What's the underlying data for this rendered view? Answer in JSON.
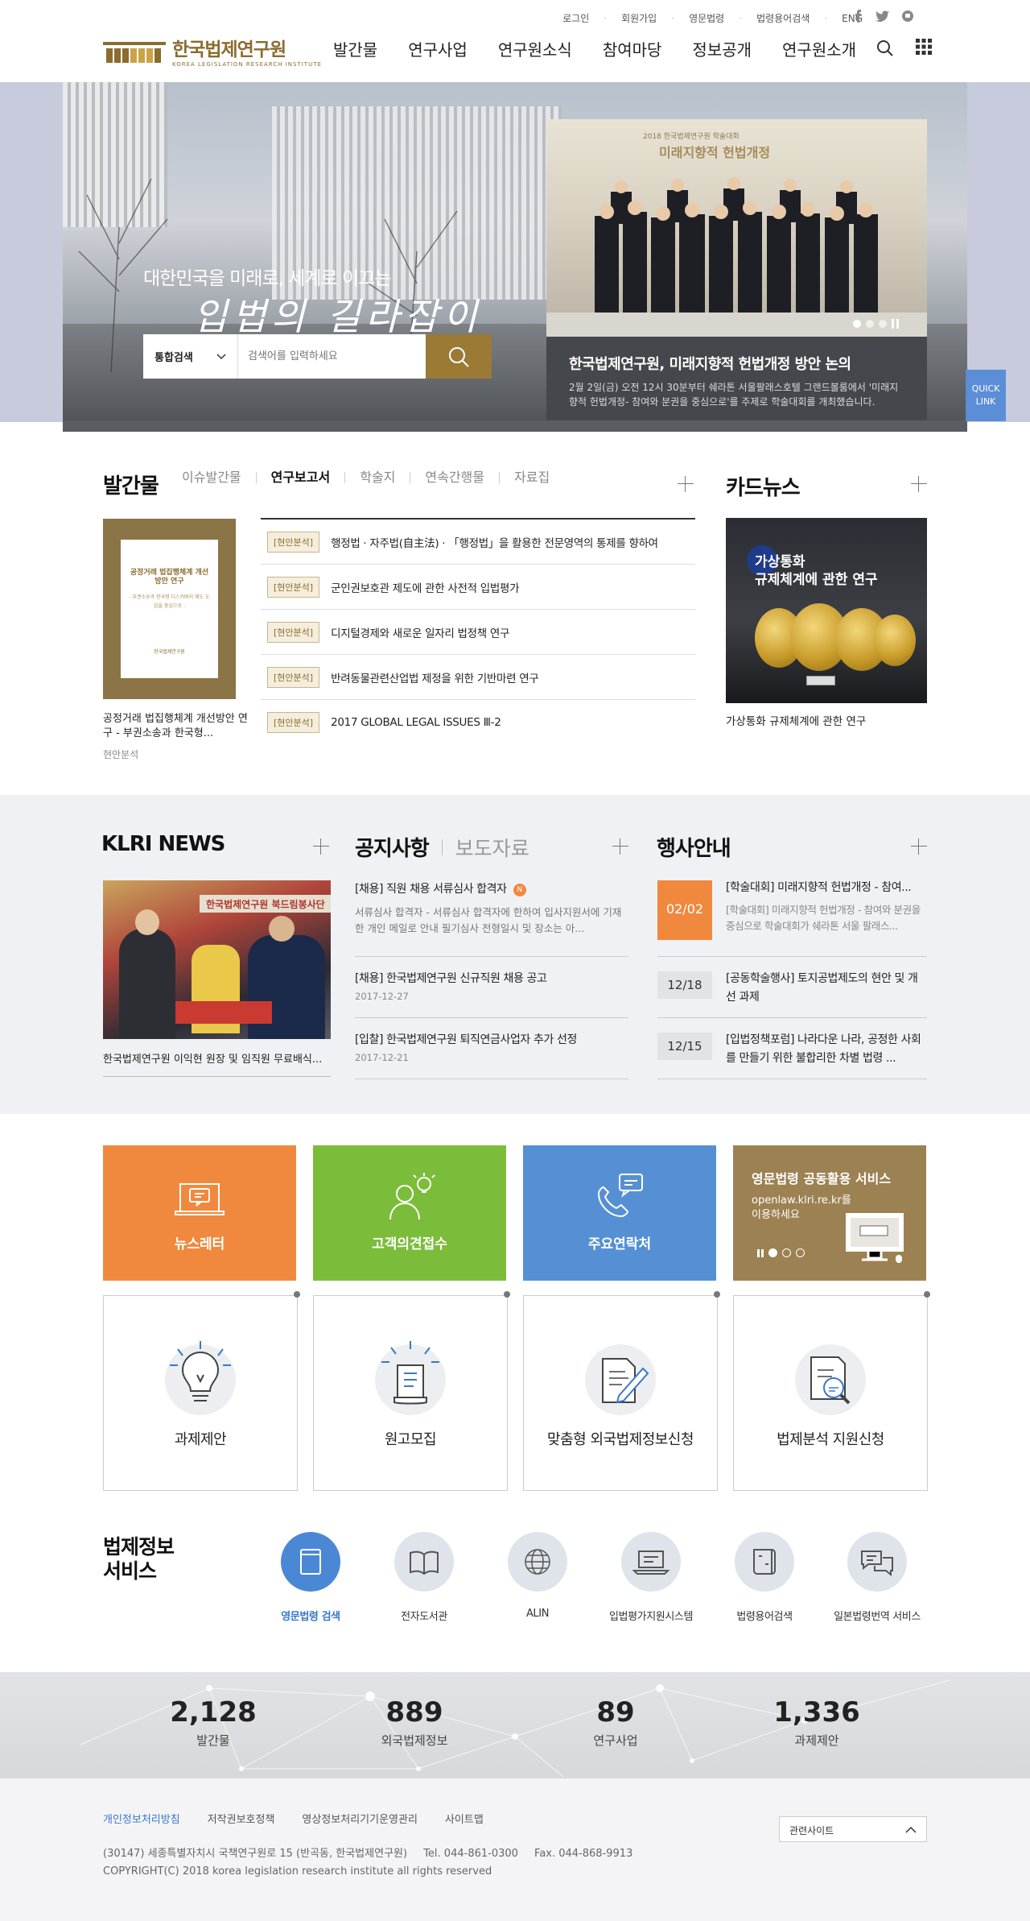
{
  "header": {
    "util_links": [
      "로그인",
      "회원가입",
      "영문법령",
      "법령용어검색",
      "ENG"
    ],
    "logo_ko": "한국법제연구원",
    "logo_en": "KOREA LEGISLATION RESEARCH INSTITUTE",
    "nav": [
      "발간물",
      "연구사업",
      "연구원소식",
      "참여마당",
      "정보공개",
      "연구원소개"
    ],
    "social_icons": [
      "facebook-icon",
      "twitter-icon",
      "blog-icon"
    ]
  },
  "hero": {
    "copy_line1": "대한민국을 미래로, 세계로 이끄는",
    "copy_line2": "입법의 길라잡이",
    "search": {
      "scope": "통합검색",
      "placeholder": "검색어를 입력하세요"
    },
    "slide": {
      "banner": "2018 한국법제연구원 학술대회",
      "banner_sub": "미래지향적 헌법개정",
      "title": "한국법제연구원, 미래지향적 헌법개정 방안 논의",
      "desc": "2월 2일(금) 오전 12시 30분부터 쉐라톤 서울팔래스호텔 그랜드볼룸에서 '미래지향적 헌법개정- 참여와 분권을 중심으로'를 주제로 학술대회를 개최했습니다."
    },
    "quick_link": [
      "QUICK",
      "LINK"
    ]
  },
  "publications": {
    "title": "발간물",
    "tabs": [
      "이슈발간물",
      "연구보고서",
      "학술지",
      "연속간행물",
      "자료집"
    ],
    "active_tab": "연구보고서",
    "featured": {
      "cover_title": "공정거래 법집행체계 개선방안 연구",
      "cover_sub": "- 부권소송과 한국형 디스커버리 제도 도입을 중심으로 -",
      "title": "공정거래 법집행체계 개선방안 연구 - 부권소송과 한국형...",
      "category": "현안분석"
    },
    "items": [
      {
        "tag": "[현안분석]",
        "title": "행정법 · 자주법(自主法) · 「행정법」을 활용한 전문영역의 통제를 향하여"
      },
      {
        "tag": "[현안분석]",
        "title": "군인권보호관 제도에 관한 사전적 입법평가"
      },
      {
        "tag": "[현안분석]",
        "title": "디지털경제와 새로운 일자리 법정책 연구"
      },
      {
        "tag": "[현안분석]",
        "title": "반려동물관련산업법 제정을 위한 기반마련 연구"
      },
      {
        "tag": "[현안분석]",
        "title": "2017 GLOBAL LEGAL ISSUES Ⅲ-2"
      }
    ]
  },
  "card_news": {
    "title": "카드뉴스",
    "image_text": [
      "가상통화",
      "규제체계에 관한 연구"
    ],
    "caption": "가상통화 규제체계에 관한 연구"
  },
  "klri_news": {
    "title": "KLRI NEWS",
    "caption": "한국법제연구원 이익현 원장 및 임직원 무료배식...",
    "banner_text": "한국법제연구원 북드림봉사단"
  },
  "notice": {
    "tab_active": "공지사항",
    "tab_other": "보도자료",
    "items": [
      {
        "title": "[채용] 직원 채용 서류심사 합격자",
        "badge": "N",
        "excerpt": "서류심사 합격자 - 서류심사 합격자에 한하여 입사지원서에 기재한 개인 메일로 안내 필기심사 전형일시 및 장소는 아..."
      },
      {
        "title": "[채용] 한국법제연구원 신규직원 채용 공고",
        "date": "2017-12-27"
      },
      {
        "title": "[입찰] 한국법제연구원 퇴직연금사업자 추가 선정",
        "date": "2017-12-21"
      }
    ]
  },
  "events": {
    "title": "행사안내",
    "items": [
      {
        "date": "02/02",
        "title": "[학술대회] 미래지향적 헌법개정 - 참여...",
        "excerpt": "[학술대회] 미래지향적 헌법개정 - 참여와 분권을 중심으로 학술대회가 쉐라톤 서울 팔래스..."
      },
      {
        "date": "12/18",
        "title": "[공동학술행사] 토지공법제도의 현안 및 개선 과제"
      },
      {
        "date": "12/15",
        "title": "[입법정책포럼] 나라다운 나라, 공정한 사회를 만들기 위한 불합리한 차별 법령 ..."
      }
    ]
  },
  "tiles": [
    {
      "label": "뉴스레터",
      "color": "#f0893e",
      "icon": "newsletter-icon"
    },
    {
      "label": "고객의견접수",
      "color": "#7bbd3a",
      "icon": "customer-idea-icon"
    },
    {
      "label": "주요연락처",
      "color": "#5690d4",
      "icon": "phone-chat-icon"
    },
    {
      "label": "영문법령 공동활용 서비스",
      "color": "#9c8152",
      "sub1": "openlaw.klri.re.kr를",
      "sub2": "이용하세요",
      "icon": "monitor-icon"
    }
  ],
  "boxes": [
    {
      "label": "과제제안",
      "icon": "lightbulb-icon"
    },
    {
      "label": "원고모집",
      "icon": "document-icon"
    },
    {
      "label": "맞춤형  외국법제정보신청",
      "icon": "pen-paper-icon"
    },
    {
      "label": "법제분석 지원신청",
      "icon": "magnifier-doc-icon"
    }
  ],
  "legal_services": {
    "title_line1": "법제정보",
    "title_line2": "서비스",
    "items": [
      {
        "label": "영문법령 검색",
        "active": true,
        "icon": "law-book-icon"
      },
      {
        "label": "전자도서관",
        "icon": "open-book-icon"
      },
      {
        "label": "ALIN",
        "icon": "globe-icon"
      },
      {
        "label": "입법평가지원시스템",
        "icon": "laptop-icon"
      },
      {
        "label": "법령용어검색",
        "icon": "scroll-icon"
      },
      {
        "label": "일본법령번역 서비스",
        "icon": "chat-bubbles-icon"
      }
    ]
  },
  "stats": [
    {
      "value": "2,128",
      "label": "발간물"
    },
    {
      "value": "889",
      "label": "외국법제정보"
    },
    {
      "value": "89",
      "label": "연구사업"
    },
    {
      "value": "1,336",
      "label": "과제제안"
    }
  ],
  "footer": {
    "links": [
      "개인정보처리방침",
      "저작권보호정책",
      "영상정보처리기기운영관리",
      "사이트맵"
    ],
    "related_sites": "관련사이트",
    "address": "(30147) 세종특별자치시 국책연구원로 15 (반곡동, 한국법제연구원)",
    "tel": "Tel. 044-861-0300",
    "fax": "Fax. 044-868-9913",
    "copyright": "COPYRIGHT(C) 2018 korea legislation research institute all rights reserved"
  }
}
